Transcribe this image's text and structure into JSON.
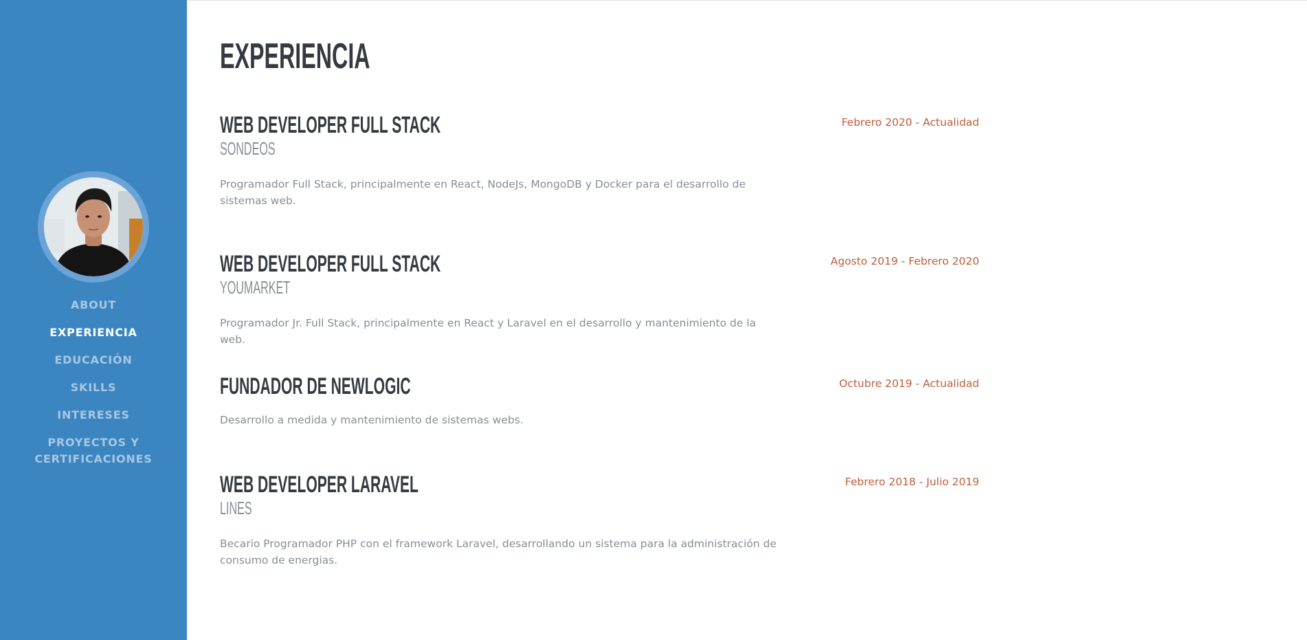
{
  "sidebar": {
    "avatar_alt": "Profile photo",
    "nav": [
      {
        "label": "About",
        "active": false
      },
      {
        "label": "Experiencia",
        "active": true
      },
      {
        "label": "Educación",
        "active": false
      },
      {
        "label": "Skills",
        "active": false
      },
      {
        "label": "Intereses",
        "active": false
      },
      {
        "label": "Proyectos y Certificaciones",
        "active": false
      }
    ]
  },
  "main": {
    "title": "Experiencia",
    "entries": [
      {
        "role": "Web Developer Full Stack",
        "company": "Sondeos",
        "description": "Programador Full Stack, principalmente en React, NodeJs, MongoDB y Docker para el desarrollo de sistemas web.",
        "dates": "Febrero 2020 - Actualidad"
      },
      {
        "role": "Web Developer Full Stack",
        "company": "YouMarket",
        "description": "Programador Jr. Full Stack, principalmente en React y Laravel en el desarrollo y mantenimiento de la web.",
        "dates": "Agosto 2019 - Febrero 2020"
      },
      {
        "role": "Fundador de NewLogic",
        "company": "",
        "description": "Desarrollo a medida y mantenimiento de sistemas webs.",
        "dates": "Octubre 2019 - Actualidad"
      },
      {
        "role": "Web Developer Laravel",
        "company": "Lines",
        "description": "Becario Programador PHP con el framework Laravel, desarrollando un sistema para la administración de consumo de energias.",
        "dates": "Febrero 2018 - Julio 2019"
      }
    ]
  },
  "colors": {
    "sidebar_bg": "#3b85c1",
    "accent_date": "#bd5d38",
    "heading": "#343a40",
    "muted": "#868e96"
  }
}
